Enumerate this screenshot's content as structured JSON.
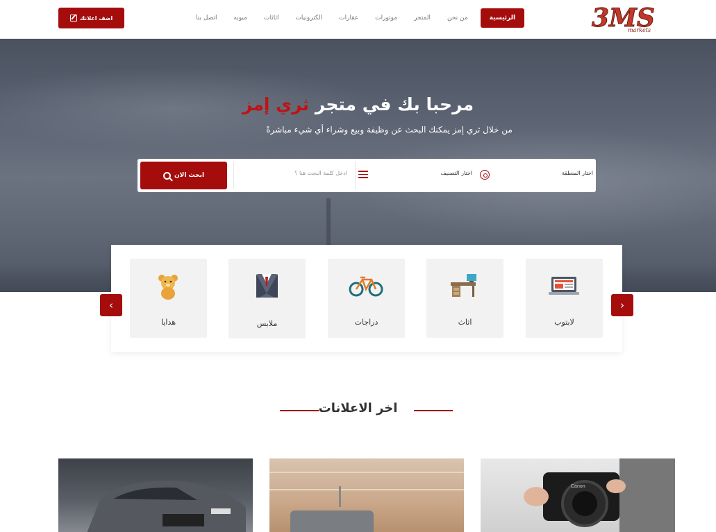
{
  "nav": {
    "add_ad_label": "اضف اعلانك",
    "menu": [
      {
        "label": "الرئيسية",
        "active": true
      },
      {
        "label": "من نحن"
      },
      {
        "label": "المتجر"
      },
      {
        "label": "موتورات"
      },
      {
        "label": "عقارات"
      },
      {
        "label": "الكترونيات"
      },
      {
        "label": "اثاثات"
      },
      {
        "label": "مبوبه"
      },
      {
        "label": "اتصل بنا"
      }
    ],
    "logo_text": "3MS",
    "logo_sub": "markets"
  },
  "hero": {
    "title_prefix": "مرحبا بك في متجر",
    "title_brand": "ثري إمز",
    "subtitle": "من خلال ثري إمز يمكنك البحث عن وظيفة وبيع وشراء أي شيء مباشرةً"
  },
  "search": {
    "button_label": "ابحث الان",
    "keyword_placeholder": "ادخل كلمة البحث هنا ؟",
    "category_label": "اختار التصنيف",
    "region_label": "اختار المنطقة"
  },
  "categories": [
    {
      "label": "لابتوب",
      "icon": "laptop-icon"
    },
    {
      "label": "اثاث",
      "icon": "desk-icon"
    },
    {
      "label": "دراجات",
      "icon": "bicycle-icon"
    },
    {
      "label": "ملابس",
      "icon": "suit-icon"
    },
    {
      "label": "هدايا",
      "icon": "teddy-bear-icon"
    }
  ],
  "section": {
    "latest_title": "اخر الاعلانات"
  },
  "colors": {
    "accent": "#a50d0d"
  }
}
